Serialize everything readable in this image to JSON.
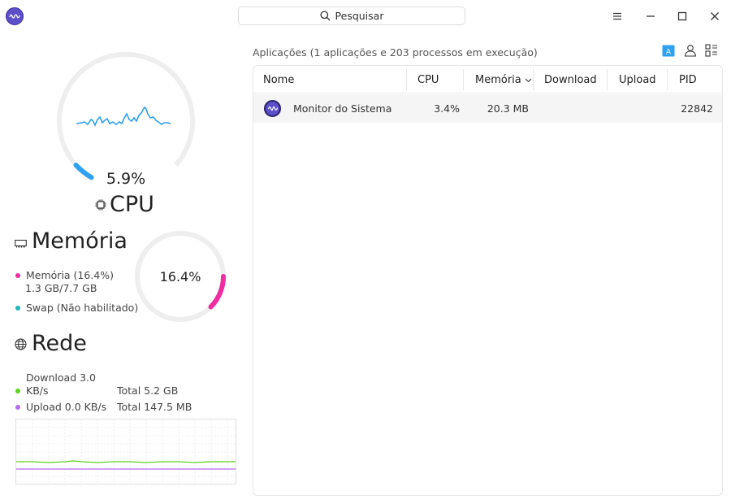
{
  "window": {
    "search_placeholder": "Pesquisar"
  },
  "cpu": {
    "usage": "5.9%",
    "usage_fraction": 0.059,
    "title": "CPU"
  },
  "memory": {
    "title": "Memória",
    "usage": "16.4%",
    "usage_fraction": 0.164,
    "legend_memory": "Memória (16.4%)",
    "legend_memory_detail": "1.3 GB/7.7 GB",
    "legend_swap": "Swap (Não habilitado)"
  },
  "network": {
    "title": "Rede",
    "download": "Download 3.0 KB/s",
    "download_total": "Total 5.2 GB",
    "upload": "Upload 0.0 KB/s",
    "upload_total": "Total 147.5 MB"
  },
  "apps": {
    "caption": "Aplicações (1 aplicações e 203 processos em execução)",
    "columns": [
      "Nome",
      "CPU",
      "Memória",
      "Download",
      "Upload",
      "PID"
    ],
    "rows": [
      {
        "name": "Monitor do Sistema",
        "cpu": "3.4%",
        "memory": "20.3 MB",
        "download": "",
        "upload": "",
        "pid": "22842"
      }
    ]
  },
  "colors": {
    "cpu_accent": "#2ea1f0",
    "memory_accent": "#f02da0",
    "swap": "#1fb8b8",
    "download": "#5ed11f",
    "upload": "#b46cf0",
    "app_icon": "#5c4fc9",
    "view_active": "#2ea1f0"
  },
  "icons": {
    "app": "system-monitor-icon",
    "search": "search-icon",
    "menu": "hamburger-menu-icon",
    "minimize": "minimize-icon",
    "maximize": "maximize-icon",
    "close": "close-icon",
    "cpu": "cpu-chip-icon",
    "memory": "memory-module-icon",
    "network": "globe-icon",
    "sort": "chevron-down-icon"
  }
}
